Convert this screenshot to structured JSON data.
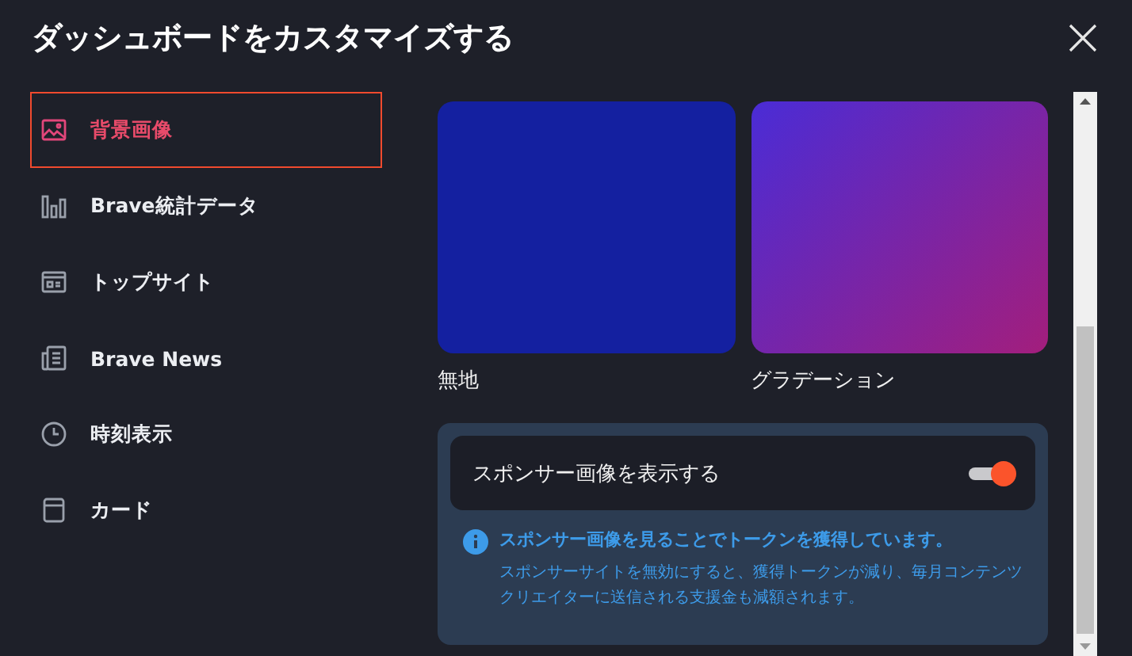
{
  "window": {
    "title": "ダッシュボードをカスタマイズする"
  },
  "sidebar": {
    "items": [
      {
        "label": "背景画像",
        "kind": "image",
        "selected": true
      },
      {
        "label": "Brave統計データ",
        "kind": "stats",
        "selected": false
      },
      {
        "label": "トップサイト",
        "kind": "sites",
        "selected": false
      },
      {
        "label": "Brave News",
        "kind": "news",
        "selected": false
      },
      {
        "label": "時刻表示",
        "kind": "clock",
        "selected": false
      },
      {
        "label": "カード",
        "kind": "card",
        "selected": false
      }
    ]
  },
  "backgrounds": [
    {
      "label": "無地",
      "kind": "solid"
    },
    {
      "label": "グラデーション",
      "kind": "gradient"
    }
  ],
  "sponsored": {
    "label": "スポンサー画像を表示する",
    "on": true,
    "info_title": "スポンサー画像を見ることでトークンを獲得しています。",
    "info_body": "スポンサーサイトを無効にすると、獲得トークンが減り、毎月コンテンツクリエイターに送信される支援金も減額されます。"
  }
}
